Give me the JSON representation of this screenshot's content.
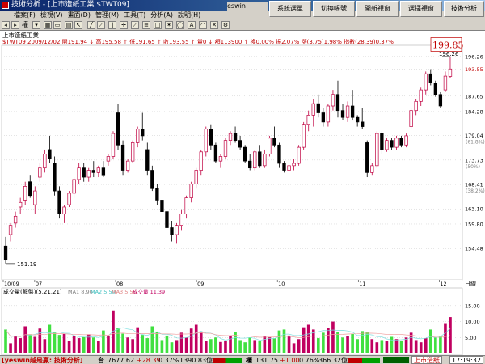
{
  "window": {
    "title": "技術分析 - [上市造紙工業 $TWT09]"
  },
  "menu": [
    "檔案(F)",
    "檢視(V)",
    "畫面(D)",
    "管理(M)",
    "工具(T)",
    "分析(A)",
    "說明(H)"
  ],
  "logo": "eswin",
  "top_buttons": [
    "系統選單",
    "切換帳號",
    "開新視窗",
    "選擇視窗",
    "技術分析"
  ],
  "toolbar": {
    "period_label": "權"
  },
  "header": {
    "symbol": "上市造紙工業",
    "quote": "$TWT09 2009/12/02 開191.94 ↓ 高195.58 ↑ 低191.65 ↑ 收193.55 ↑ 量0 ↓ 額113900 ↑ 換0.00% 振2.07% 漲(3.75)1.98% 指數(28.39)0.37%"
  },
  "chart_data": [
    {
      "type": "candlestick",
      "ylim": [
        148.0,
        198.0
      ],
      "y_ticks": [
        196.26,
        193.55,
        187.65,
        184.28,
        179.04,
        173.73,
        168.41,
        163.1,
        159.8,
        154.48
      ],
      "y_tick_notes": {
        "179.04": "(61.8%)",
        "173.73": "(50%)",
        "168.41": "(38.2%)"
      },
      "x_tick_labels": [
        "10/09",
        "07",
        "08",
        "09",
        "10",
        "11",
        "12"
      ],
      "annotations": {
        "high": "196.26",
        "low": "151.19",
        "cursor": "199.85",
        "last": "193.55"
      },
      "series": [
        {
          "o": 155,
          "h": 157,
          "l": 151.19,
          "c": 152
        },
        {
          "o": 157.5,
          "h": 160,
          "l": 156,
          "c": 159.5
        },
        {
          "o": 160,
          "h": 162.5,
          "l": 159,
          "c": 161.5
        },
        {
          "o": 163.5,
          "h": 165.5,
          "l": 162,
          "c": 164.5
        },
        {
          "o": 165,
          "h": 169,
          "l": 164,
          "c": 168
        },
        {
          "o": 169,
          "h": 170.5,
          "l": 165.5,
          "c": 166
        },
        {
          "o": 164,
          "h": 168,
          "l": 162,
          "c": 167
        },
        {
          "o": 170,
          "h": 173,
          "l": 169,
          "c": 172
        },
        {
          "o": 172,
          "h": 176,
          "l": 171,
          "c": 175
        },
        {
          "o": 176,
          "h": 179,
          "l": 173,
          "c": 174
        },
        {
          "o": 173,
          "h": 174.5,
          "l": 166,
          "c": 167
        },
        {
          "o": 167,
          "h": 168,
          "l": 161,
          "c": 162
        },
        {
          "o": 162,
          "h": 164,
          "l": 160,
          "c": 163.5
        },
        {
          "o": 164,
          "h": 167,
          "l": 163.5,
          "c": 166.5
        },
        {
          "o": 166.5,
          "h": 170,
          "l": 165.5,
          "c": 169.5
        },
        {
          "o": 169.5,
          "h": 173,
          "l": 168.5,
          "c": 172
        },
        {
          "o": 172,
          "h": 173,
          "l": 169,
          "c": 170
        },
        {
          "o": 170,
          "h": 172,
          "l": 169,
          "c": 171.5
        },
        {
          "o": 171.5,
          "h": 173.5,
          "l": 170,
          "c": 171
        },
        {
          "o": 171,
          "h": 172.5,
          "l": 170,
          "c": 172
        },
        {
          "o": 172,
          "h": 173.5,
          "l": 170,
          "c": 170.5
        },
        {
          "o": 173.5,
          "h": 175,
          "l": 172.5,
          "c": 174.5
        },
        {
          "o": 174.5,
          "h": 180,
          "l": 174,
          "c": 179.5
        },
        {
          "o": 184,
          "h": 186,
          "l": 176,
          "c": 177
        },
        {
          "o": 177,
          "h": 178,
          "l": 170.5,
          "c": 171.5
        },
        {
          "o": 171.5,
          "h": 174,
          "l": 171,
          "c": 173.5
        },
        {
          "o": 173.5,
          "h": 178,
          "l": 173,
          "c": 177.5
        },
        {
          "o": 177.5,
          "h": 181,
          "l": 176.5,
          "c": 180.5
        },
        {
          "o": 180.5,
          "h": 184,
          "l": 178,
          "c": 179
        },
        {
          "o": 176,
          "h": 177.5,
          "l": 170.5,
          "c": 171.5
        },
        {
          "o": 171.5,
          "h": 172.5,
          "l": 167,
          "c": 167.5
        },
        {
          "o": 167.5,
          "h": 168.5,
          "l": 164,
          "c": 165
        },
        {
          "o": 165,
          "h": 166,
          "l": 162,
          "c": 162.5
        },
        {
          "o": 162.5,
          "h": 163.5,
          "l": 158,
          "c": 159
        },
        {
          "o": 159,
          "h": 160.5,
          "l": 156,
          "c": 157.5
        },
        {
          "o": 157.5,
          "h": 160,
          "l": 155.5,
          "c": 159.5
        },
        {
          "o": 159.5,
          "h": 163,
          "l": 158.5,
          "c": 162
        },
        {
          "o": 162,
          "h": 166,
          "l": 161,
          "c": 165.5
        },
        {
          "o": 165.5,
          "h": 169,
          "l": 164.5,
          "c": 168.5
        },
        {
          "o": 168.5,
          "h": 172,
          "l": 167.5,
          "c": 171.5
        },
        {
          "o": 171.5,
          "h": 176,
          "l": 170.5,
          "c": 175.5
        },
        {
          "o": 175.5,
          "h": 181,
          "l": 174.5,
          "c": 180.5
        },
        {
          "o": 180.5,
          "h": 181.5,
          "l": 176,
          "c": 177
        },
        {
          "o": 177,
          "h": 177.5,
          "l": 173,
          "c": 173.5
        },
        {
          "o": 173.5,
          "h": 175,
          "l": 172,
          "c": 174.5
        },
        {
          "o": 174.5,
          "h": 178.5,
          "l": 174,
          "c": 178
        },
        {
          "o": 178,
          "h": 180,
          "l": 177,
          "c": 179.5
        },
        {
          "o": 179.5,
          "h": 181,
          "l": 177.5,
          "c": 178
        },
        {
          "o": 178,
          "h": 179,
          "l": 176,
          "c": 176.5
        },
        {
          "o": 176.5,
          "h": 177,
          "l": 173,
          "c": 173.5
        },
        {
          "o": 173.5,
          "h": 175,
          "l": 171.5,
          "c": 172
        },
        {
          "o": 172,
          "h": 176,
          "l": 171.5,
          "c": 175.5
        },
        {
          "o": 175.5,
          "h": 177,
          "l": 172,
          "c": 172.5
        },
        {
          "o": 172.5,
          "h": 176,
          "l": 172,
          "c": 175
        },
        {
          "o": 175,
          "h": 179,
          "l": 174.5,
          "c": 178.5
        },
        {
          "o": 178.5,
          "h": 181,
          "l": 176.5,
          "c": 177
        },
        {
          "o": 177,
          "h": 177.5,
          "l": 172,
          "c": 173
        },
        {
          "o": 173,
          "h": 173.5,
          "l": 171,
          "c": 171.5
        },
        {
          "o": 171.5,
          "h": 173,
          "l": 170.5,
          "c": 172.5
        },
        {
          "o": 172.5,
          "h": 174,
          "l": 171.5,
          "c": 173
        },
        {
          "o": 173,
          "h": 177,
          "l": 172.5,
          "c": 176.5
        },
        {
          "o": 176.5,
          "h": 182,
          "l": 176,
          "c": 181.5
        },
        {
          "o": 181.5,
          "h": 184.5,
          "l": 180,
          "c": 183.5
        },
        {
          "o": 183.5,
          "h": 187,
          "l": 181,
          "c": 186
        },
        {
          "o": 186,
          "h": 188,
          "l": 183,
          "c": 184
        },
        {
          "o": 184,
          "h": 185,
          "l": 181,
          "c": 182
        },
        {
          "o": 182,
          "h": 186,
          "l": 181,
          "c": 185.5
        },
        {
          "o": 185.5,
          "h": 189,
          "l": 184.5,
          "c": 188
        },
        {
          "o": 188,
          "h": 191,
          "l": 183,
          "c": 184.5
        },
        {
          "o": 184.5,
          "h": 186,
          "l": 182.5,
          "c": 183
        },
        {
          "o": 183,
          "h": 186.5,
          "l": 182,
          "c": 185.5
        },
        {
          "o": 185.5,
          "h": 189,
          "l": 182.5,
          "c": 183
        },
        {
          "o": 183,
          "h": 183.5,
          "l": 181,
          "c": 182
        },
        {
          "o": 182,
          "h": 185,
          "l": 180.5,
          "c": 181
        },
        {
          "o": 177.5,
          "h": 178,
          "l": 170,
          "c": 171
        },
        {
          "o": 171,
          "h": 173,
          "l": 170.5,
          "c": 172.5
        },
        {
          "o": 172.5,
          "h": 180,
          "l": 172,
          "c": 179.5
        },
        {
          "o": 179.5,
          "h": 180,
          "l": 175,
          "c": 176
        },
        {
          "o": 176,
          "h": 178.5,
          "l": 175.5,
          "c": 178
        },
        {
          "o": 178,
          "h": 178.5,
          "l": 176,
          "c": 176.5
        },
        {
          "o": 176.5,
          "h": 179,
          "l": 176,
          "c": 178.5
        },
        {
          "o": 178.5,
          "h": 179,
          "l": 176.5,
          "c": 177
        },
        {
          "o": 177,
          "h": 179.5,
          "l": 176.5,
          "c": 179
        },
        {
          "o": 181,
          "h": 185,
          "l": 180.5,
          "c": 184.5
        },
        {
          "o": 184.5,
          "h": 187,
          "l": 183.5,
          "c": 186.5
        },
        {
          "o": 186.5,
          "h": 189.5,
          "l": 185.5,
          "c": 189
        },
        {
          "o": 189,
          "h": 193,
          "l": 188,
          "c": 192.5
        },
        {
          "o": 192.5,
          "h": 193.5,
          "l": 190,
          "c": 190.5
        },
        {
          "o": 190.5,
          "h": 191,
          "l": 187.5,
          "c": 188
        },
        {
          "o": 188,
          "h": 188.5,
          "l": 185,
          "c": 185.5
        },
        {
          "o": 189,
          "h": 193,
          "l": 188.5,
          "c": 192
        },
        {
          "o": 191.94,
          "h": 196.26,
          "l": 191.65,
          "c": 193.55
        }
      ]
    },
    {
      "type": "bar",
      "title": "成交量(解盤)(5,21,21)",
      "legend": [
        {
          "name": "MA1 8.90",
          "color": "#808080"
        },
        {
          "name": "MA2 5.50",
          "color": "#80e0e0"
        },
        {
          "name": "MA3 5.50",
          "color": "#f0a0a0"
        },
        {
          "name": "成交量 11.39",
          "color": "#c00060"
        }
      ],
      "ylim": [
        0,
        18
      ],
      "y_ticks": [
        15.0,
        10.0,
        5.0
      ],
      "values": [
        7.5,
        3.2,
        5.5,
        4.8,
        8.5,
        6.0,
        5.2,
        7.8,
        4.5,
        9.0,
        6.5,
        5.8,
        6.2,
        4.0,
        5.5,
        4.8,
        5.2,
        6.0,
        5.0,
        3.8,
        7.2,
        5.5,
        13.5,
        8.0,
        6.2,
        5.0,
        4.5,
        8.2,
        5.8,
        4.8,
        8.5,
        6.8,
        4.2,
        5.6,
        3.5,
        4.2,
        6.5,
        5.0,
        7.8,
        9.0,
        6.6,
        3.8,
        4.5,
        5.0,
        3.6,
        4.0,
        5.5,
        6.8,
        4.2,
        3.5,
        5.0,
        4.2,
        3.8,
        5.5,
        5.2,
        4.8,
        7.2,
        7.5,
        5.6,
        3.2,
        4.5,
        8.2,
        9.0,
        7.5,
        4.8,
        6.5,
        8.0,
        10.0,
        6.8,
        5.0,
        5.5,
        6.2,
        4.5,
        7.0,
        6.8,
        4.5,
        3.5,
        4.2,
        3.8,
        5.2,
        4.5,
        3.8,
        5.0,
        6.5,
        4.2,
        3.5,
        4.8,
        7.5,
        5.0,
        5.5,
        9.5,
        11.39
      ]
    }
  ],
  "status": {
    "brand": "[yeswin越是贏: 技術分析]",
    "m1_label": "台",
    "m1_index": "7677.62",
    "m1_change": "+28.39",
    "m1_pct": "0.37%",
    "m1_volume": "1390.83億",
    "m2_label": "櫃",
    "m2_index": "131.75",
    "m2_change": "+1.00",
    "m2_pct": "0.76%",
    "m2_volume": "366.32億",
    "right_label": "上市造紙",
    "time": "17:19:32"
  },
  "colors": {
    "up": "#c00040",
    "down": "#000000",
    "vol_up": "#c00060",
    "vol_down": "#40e040"
  }
}
